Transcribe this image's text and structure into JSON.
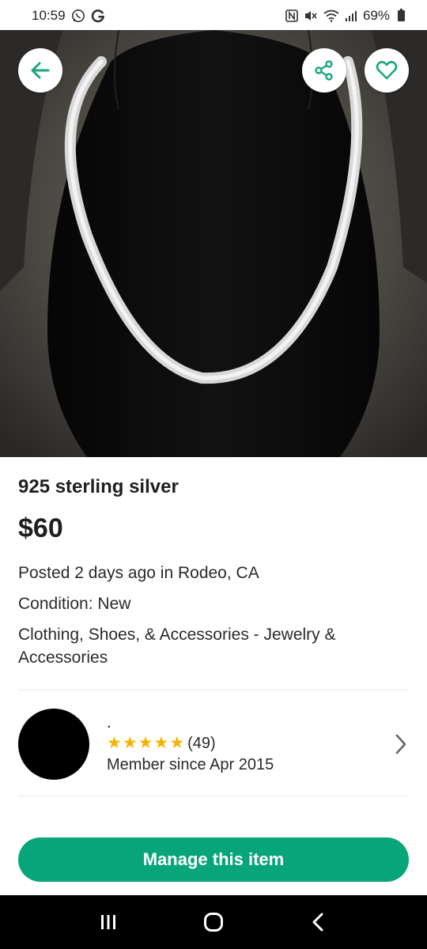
{
  "status_bar": {
    "time": "10:59",
    "battery_percent": "69%",
    "left_icons": [
      "whatsapp-icon",
      "google-icon"
    ],
    "right_icons": [
      "nfc-icon",
      "mute-icon",
      "wifi-icon",
      "signal-icon",
      "battery-icon"
    ]
  },
  "hero": {
    "image": "silver-herringbone-necklace-photo",
    "buttons": [
      "back-arrow-icon",
      "share-icon",
      "heart-icon"
    ]
  },
  "listing": {
    "title": "925 sterling silver",
    "price": "$60",
    "posted": "Posted 2 days ago in Rodeo, CA",
    "condition": "Condition: New",
    "category": "Clothing, Shoes, & Accessories - Jewelry & Accessories"
  },
  "seller": {
    "name": ".",
    "stars": 5,
    "rating_count": "(49)",
    "member_since": "Member since Apr 2015"
  },
  "actions": {
    "manage_label": "Manage this item"
  },
  "colors": {
    "accent": "#09a57a",
    "star": "#f5b301",
    "icon": "#1aa77f"
  }
}
